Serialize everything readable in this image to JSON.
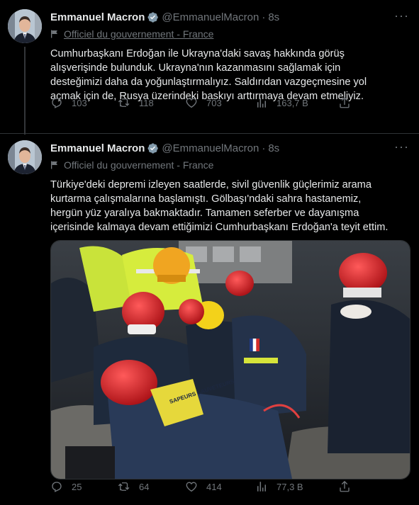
{
  "tweets": [
    {
      "author": "Emmanuel Macron",
      "handle": "@EmmanuelMacron",
      "separator": "·",
      "time": "8s",
      "label": "Officiel du gouvernement - France",
      "text": "Cumhurbaşkanı Erdoğan ile Ukrayna'daki savaş hakkında görüş\nalışverişinde bulunduk. Ukrayna'nın kazanmasını sağlamak için\ndesteğimizi daha da yoğunlaştırmalıyız. Saldırıdan vazgeçmesine yol\naçmak için de, Rusya üzerindeki baskıyı arttırmaya devam etmeliyiz.",
      "replies": "103",
      "retweets": "118",
      "likes": "703",
      "views": "163,7 B"
    },
    {
      "author": "Emmanuel Macron",
      "handle": "@EmmanuelMacron",
      "separator": "·",
      "time": "8s",
      "label": "Officiel du gouvernement - France",
      "text": "Türkiye'deki depremi izleyen saatlerde, sivil güvenlik güçlerimiz arama\nkurtarma çalışmalarına başlamıştı. Gölbaşı'ndaki sahra hastanemiz,\nhergün yüz yaralıya bakmaktadır. Tamamen seferber ve dayanışma\niçerisinde kalmaya devam ettiğimizi Cumhurbaşkanı Erdoğan'a teyit ettim.",
      "photo_vest_text": "SAPEURS SAUVETEURS",
      "replies": "25",
      "retweets": "64",
      "likes": "414",
      "views": "77,3 B"
    }
  ],
  "icons": [
    "verified-badge-icon",
    "more-options-icon",
    "government-flag-icon",
    "reply-icon",
    "retweet-icon",
    "like-icon",
    "views-icon",
    "share-icon"
  ],
  "colors": {
    "background": "#000000",
    "text": "#e7e9ea",
    "muted": "#71767b",
    "verified": "#829aab",
    "divider": "#2f3336"
  }
}
